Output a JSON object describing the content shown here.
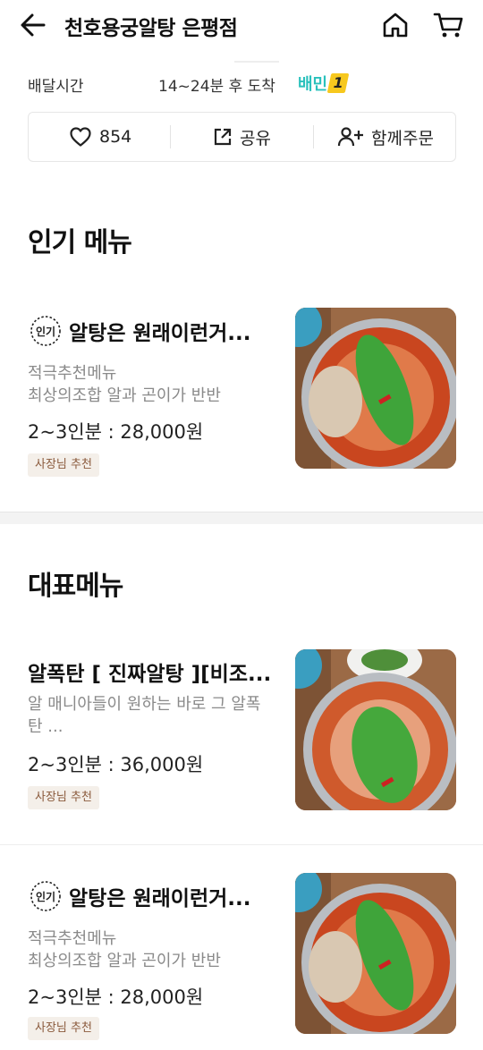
{
  "header": {
    "title": "천호용궁알탕 은평점",
    "back_icon": "arrow-left-icon",
    "home_icon": "home-icon",
    "cart_icon": "cart-icon"
  },
  "delivery": {
    "label": "배달시간",
    "value": "14~24분 후 도착",
    "badge_text": "배민",
    "badge_number": "1",
    "badge_color": "#2ac1bc"
  },
  "actions": {
    "like_count": "854",
    "share_label": "공유",
    "group_order_label": "함께주문"
  },
  "sections": {
    "popular_title": "인기 메뉴",
    "signature_title": "대표메뉴"
  },
  "menus": [
    {
      "popular_badge": "인기",
      "name": "알탕은 원래이런거...",
      "desc_line1": "적극추천메뉴",
      "desc_line2": "최상의조합 알과 곤이가 반반",
      "price": "2~3인분 : 28,000원",
      "tag": "사장님 추천"
    },
    {
      "name": "알폭탄 [ 진짜알탕 ][비조...",
      "desc_line1": "알 매니아들이 원하는 바로 그 알폭",
      "desc_line2": "탄 ...",
      "price": "2~3인분 : 36,000원",
      "tag": "사장님 추천"
    },
    {
      "popular_badge": "인기",
      "name": "알탕은 원래이런거...",
      "desc_line1": "적극추천메뉴",
      "desc_line2": "최상의조합 알과 곤이가 반반",
      "price": "2~3인분 : 28,000원",
      "tag": "사장님 추천"
    }
  ]
}
